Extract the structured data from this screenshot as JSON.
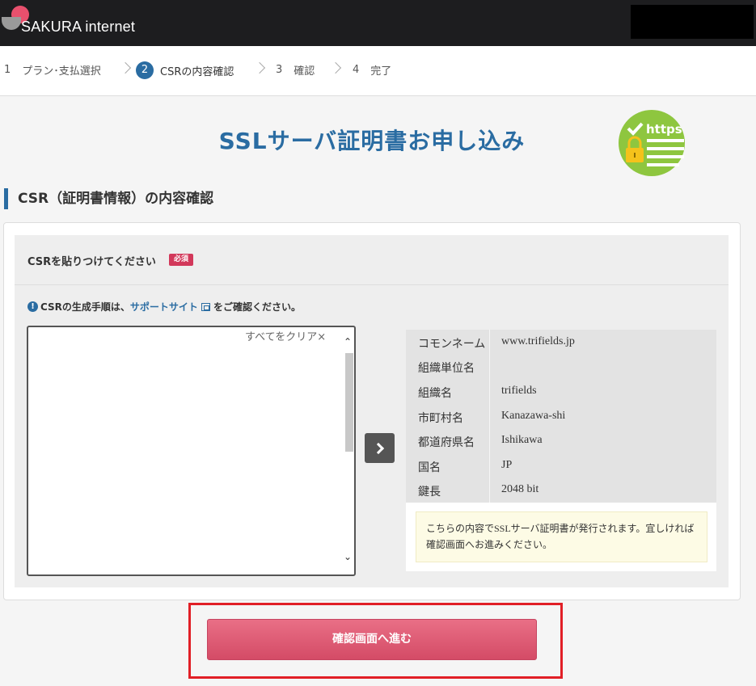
{
  "header": {
    "brand": "SAKURA internet"
  },
  "stepper": {
    "steps": [
      {
        "num": "1",
        "label": "プラン･支払選択"
      },
      {
        "num": "2",
        "label": "CSRの内容確認"
      },
      {
        "num": "3",
        "label": "確認"
      },
      {
        "num": "4",
        "label": "完了"
      }
    ],
    "active": 2
  },
  "page": {
    "title": "SSLサーバ証明書お申し込み",
    "badge_text": "https",
    "section_heading": "CSR（証明書情報）の内容確認"
  },
  "form": {
    "csr_label": "CSRを貼りつけてください",
    "required_badge": "必須",
    "note_prefix": "CSRの生成手順は、",
    "note_link": "サポートサイト",
    "note_suffix": "をご確認ください。",
    "clear_all": "すべてをクリア×",
    "csr_value": ""
  },
  "result": {
    "rows": [
      {
        "key": "コモンネーム",
        "value": "www.trifields.jp"
      },
      {
        "key": "組織単位名",
        "value": ""
      },
      {
        "key": "組織名",
        "value": "trifields"
      },
      {
        "key": "市町村名",
        "value": "Kanazawa-shi"
      },
      {
        "key": "都道府県名",
        "value": "Ishikawa"
      },
      {
        "key": "国名",
        "value": "JP"
      },
      {
        "key": "鍵長",
        "value": "2048 bit"
      }
    ],
    "note": "こちらの内容でSSLサーバ証明書が発行されます。宜しければ 確認画面へお進みください。"
  },
  "submit": {
    "label": "確認画面へ進む"
  },
  "colors": {
    "brand_blue": "#2a6ca2",
    "accent_pink": "#e8506d",
    "button": "#d44b66",
    "highlight_border": "#e11f26"
  }
}
